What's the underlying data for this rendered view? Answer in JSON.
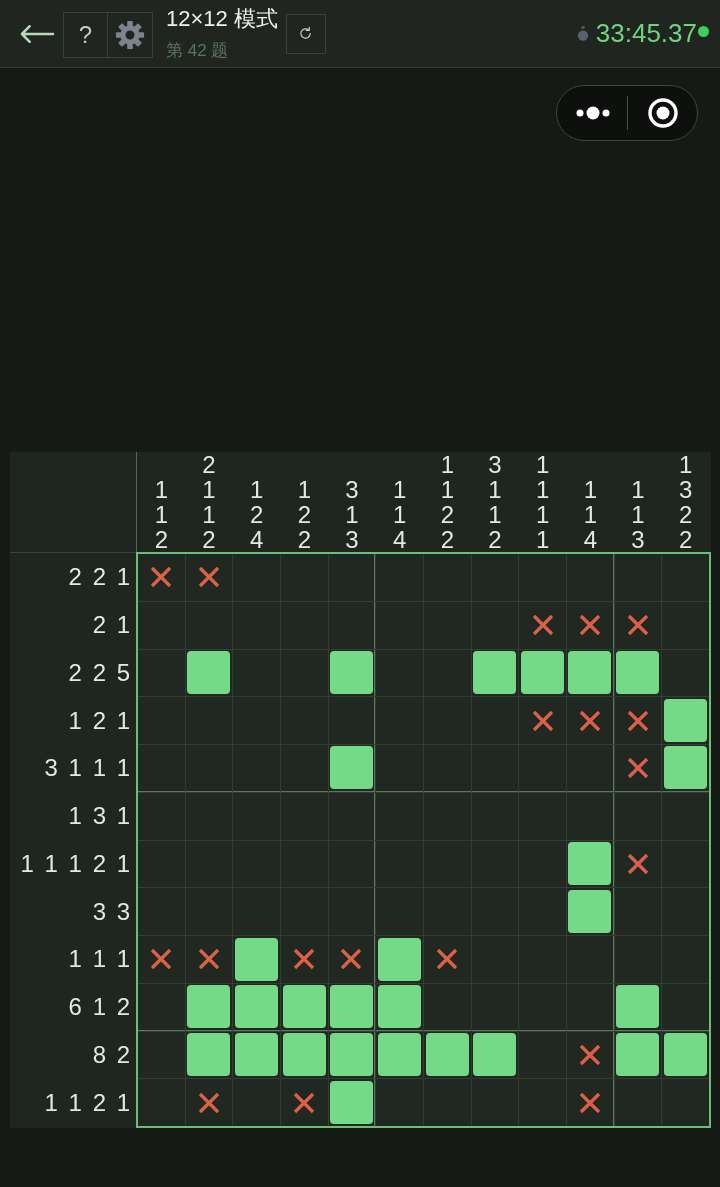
{
  "header": {
    "help_button": "?",
    "title": "12×12 模式",
    "subtitle": "第 42 题",
    "timer": "33:45.37"
  },
  "puzzle": {
    "column_clues": [
      [
        "1",
        "1",
        "2"
      ],
      [
        "2",
        "1",
        "1",
        "2"
      ],
      [
        "1",
        "2",
        "4"
      ],
      [
        "1",
        "2",
        "2"
      ],
      [
        "3",
        "1",
        "3"
      ],
      [
        "1",
        "1",
        "4"
      ],
      [
        "1",
        "1",
        "2",
        "2"
      ],
      [
        "3",
        "1",
        "1",
        "2"
      ],
      [
        "1",
        "1",
        "1",
        "1"
      ],
      [
        "1",
        "1",
        "4"
      ],
      [
        "1",
        "1",
        "3"
      ],
      [
        "1",
        "3",
        "2",
        "2"
      ]
    ],
    "rows": [
      {
        "clues": [
          "2",
          "2",
          "1"
        ],
        "cells": [
          {
            "filled": false,
            "crossed": true
          },
          {
            "filled": false,
            "crossed": true
          },
          {
            "filled": false,
            "crossed": false
          },
          {
            "filled": false,
            "crossed": false
          },
          {
            "filled": false,
            "crossed": false
          },
          {
            "filled": false,
            "crossed": false
          },
          {
            "filled": false,
            "crossed": false
          },
          {
            "filled": false,
            "crossed": false
          },
          {
            "filled": false,
            "crossed": false
          },
          {
            "filled": false,
            "crossed": false
          },
          {
            "filled": false,
            "crossed": false
          },
          {
            "filled": false,
            "crossed": false
          }
        ]
      },
      {
        "clues": [
          "2",
          "1"
        ],
        "cells": [
          {
            "filled": false,
            "crossed": false
          },
          {
            "filled": false,
            "crossed": false
          },
          {
            "filled": false,
            "crossed": false
          },
          {
            "filled": false,
            "crossed": false
          },
          {
            "filled": false,
            "crossed": false
          },
          {
            "filled": false,
            "crossed": false
          },
          {
            "filled": false,
            "crossed": false
          },
          {
            "filled": false,
            "crossed": false
          },
          {
            "filled": false,
            "crossed": true
          },
          {
            "filled": false,
            "crossed": true
          },
          {
            "filled": false,
            "crossed": true
          },
          {
            "filled": false,
            "crossed": false
          }
        ]
      },
      {
        "clues": [
          "2",
          "2",
          "5"
        ],
        "cells": [
          {
            "filled": false,
            "crossed": false
          },
          {
            "filled": true,
            "crossed": false
          },
          {
            "filled": false,
            "crossed": false
          },
          {
            "filled": false,
            "crossed": false
          },
          {
            "filled": true,
            "crossed": false
          },
          {
            "filled": false,
            "crossed": false
          },
          {
            "filled": false,
            "crossed": false
          },
          {
            "filled": true,
            "crossed": false
          },
          {
            "filled": true,
            "crossed": false
          },
          {
            "filled": true,
            "crossed": false
          },
          {
            "filled": true,
            "crossed": false
          },
          {
            "filled": false,
            "crossed": false
          }
        ]
      },
      {
        "clues": [
          "1",
          "2",
          "1"
        ],
        "cells": [
          {
            "filled": false,
            "crossed": false
          },
          {
            "filled": false,
            "crossed": false
          },
          {
            "filled": false,
            "crossed": false
          },
          {
            "filled": false,
            "crossed": false
          },
          {
            "filled": false,
            "crossed": false
          },
          {
            "filled": false,
            "crossed": false
          },
          {
            "filled": false,
            "crossed": false
          },
          {
            "filled": false,
            "crossed": false
          },
          {
            "filled": false,
            "crossed": true
          },
          {
            "filled": false,
            "crossed": true
          },
          {
            "filled": false,
            "crossed": true
          },
          {
            "filled": true,
            "crossed": false
          }
        ]
      },
      {
        "clues": [
          "3",
          "1",
          "1",
          "1"
        ],
        "cells": [
          {
            "filled": false,
            "crossed": false
          },
          {
            "filled": false,
            "crossed": false
          },
          {
            "filled": false,
            "crossed": false
          },
          {
            "filled": false,
            "crossed": false
          },
          {
            "filled": true,
            "crossed": false
          },
          {
            "filled": false,
            "crossed": false
          },
          {
            "filled": false,
            "crossed": false
          },
          {
            "filled": false,
            "crossed": false
          },
          {
            "filled": false,
            "crossed": false
          },
          {
            "filled": false,
            "crossed": false
          },
          {
            "filled": false,
            "crossed": true
          },
          {
            "filled": true,
            "crossed": false
          }
        ]
      },
      {
        "clues": [
          "1",
          "3",
          "1"
        ],
        "cells": [
          {
            "filled": false,
            "crossed": false
          },
          {
            "filled": false,
            "crossed": false
          },
          {
            "filled": false,
            "crossed": false
          },
          {
            "filled": false,
            "crossed": false
          },
          {
            "filled": false,
            "crossed": false
          },
          {
            "filled": false,
            "crossed": false
          },
          {
            "filled": false,
            "crossed": false
          },
          {
            "filled": false,
            "crossed": false
          },
          {
            "filled": false,
            "crossed": false
          },
          {
            "filled": false,
            "crossed": false
          },
          {
            "filled": false,
            "crossed": false
          },
          {
            "filled": false,
            "crossed": false
          }
        ]
      },
      {
        "clues": [
          "1",
          "1",
          "1",
          "2",
          "1"
        ],
        "cells": [
          {
            "filled": false,
            "crossed": false
          },
          {
            "filled": false,
            "crossed": false
          },
          {
            "filled": false,
            "crossed": false
          },
          {
            "filled": false,
            "crossed": false
          },
          {
            "filled": false,
            "crossed": false
          },
          {
            "filled": false,
            "crossed": false
          },
          {
            "filled": false,
            "crossed": false
          },
          {
            "filled": false,
            "crossed": false
          },
          {
            "filled": false,
            "crossed": false
          },
          {
            "filled": true,
            "crossed": false
          },
          {
            "filled": false,
            "crossed": true
          },
          {
            "filled": false,
            "crossed": false
          }
        ]
      },
      {
        "clues": [
          "3",
          "3"
        ],
        "cells": [
          {
            "filled": false,
            "crossed": false
          },
          {
            "filled": false,
            "crossed": false
          },
          {
            "filled": false,
            "crossed": false
          },
          {
            "filled": false,
            "crossed": false
          },
          {
            "filled": false,
            "crossed": false
          },
          {
            "filled": false,
            "crossed": false
          },
          {
            "filled": false,
            "crossed": false
          },
          {
            "filled": false,
            "crossed": false
          },
          {
            "filled": false,
            "crossed": false
          },
          {
            "filled": true,
            "crossed": false
          },
          {
            "filled": false,
            "crossed": false
          },
          {
            "filled": false,
            "crossed": false
          }
        ]
      },
      {
        "clues": [
          "1",
          "1",
          "1"
        ],
        "cells": [
          {
            "filled": false,
            "crossed": true
          },
          {
            "filled": false,
            "crossed": true
          },
          {
            "filled": true,
            "crossed": false
          },
          {
            "filled": false,
            "crossed": true
          },
          {
            "filled": false,
            "crossed": true
          },
          {
            "filled": true,
            "crossed": false
          },
          {
            "filled": false,
            "crossed": true
          },
          {
            "filled": false,
            "crossed": false
          },
          {
            "filled": false,
            "crossed": false
          },
          {
            "filled": false,
            "crossed": false
          },
          {
            "filled": false,
            "crossed": false
          },
          {
            "filled": false,
            "crossed": false
          }
        ]
      },
      {
        "clues": [
          "6",
          "1",
          "2"
        ],
        "cells": [
          {
            "filled": false,
            "crossed": false
          },
          {
            "filled": true,
            "crossed": false
          },
          {
            "filled": true,
            "crossed": false
          },
          {
            "filled": true,
            "crossed": false
          },
          {
            "filled": true,
            "crossed": false
          },
          {
            "filled": true,
            "crossed": false
          },
          {
            "filled": false,
            "crossed": false
          },
          {
            "filled": false,
            "crossed": false
          },
          {
            "filled": false,
            "crossed": false
          },
          {
            "filled": false,
            "crossed": false
          },
          {
            "filled": true,
            "crossed": false
          },
          {
            "filled": false,
            "crossed": false
          }
        ]
      },
      {
        "clues": [
          "8",
          "2"
        ],
        "cells": [
          {
            "filled": false,
            "crossed": false
          },
          {
            "filled": true,
            "crossed": false
          },
          {
            "filled": true,
            "crossed": false
          },
          {
            "filled": true,
            "crossed": false
          },
          {
            "filled": true,
            "crossed": false
          },
          {
            "filled": true,
            "crossed": false
          },
          {
            "filled": true,
            "crossed": false
          },
          {
            "filled": true,
            "crossed": false
          },
          {
            "filled": false,
            "crossed": false
          },
          {
            "filled": false,
            "crossed": true
          },
          {
            "filled": true,
            "crossed": false
          },
          {
            "filled": true,
            "crossed": false
          }
        ]
      },
      {
        "clues": [
          "1",
          "1",
          "2",
          "1"
        ],
        "cells": [
          {
            "filled": false,
            "crossed": false
          },
          {
            "filled": false,
            "crossed": true
          },
          {
            "filled": false,
            "crossed": false
          },
          {
            "filled": false,
            "crossed": true
          },
          {
            "filled": true,
            "crossed": false
          },
          {
            "filled": false,
            "crossed": false
          },
          {
            "filled": false,
            "crossed": false
          },
          {
            "filled": false,
            "crossed": false
          },
          {
            "filled": false,
            "crossed": false
          },
          {
            "filled": false,
            "crossed": true
          },
          {
            "filled": false,
            "crossed": false
          },
          {
            "filled": false,
            "crossed": false
          }
        ]
      }
    ]
  }
}
